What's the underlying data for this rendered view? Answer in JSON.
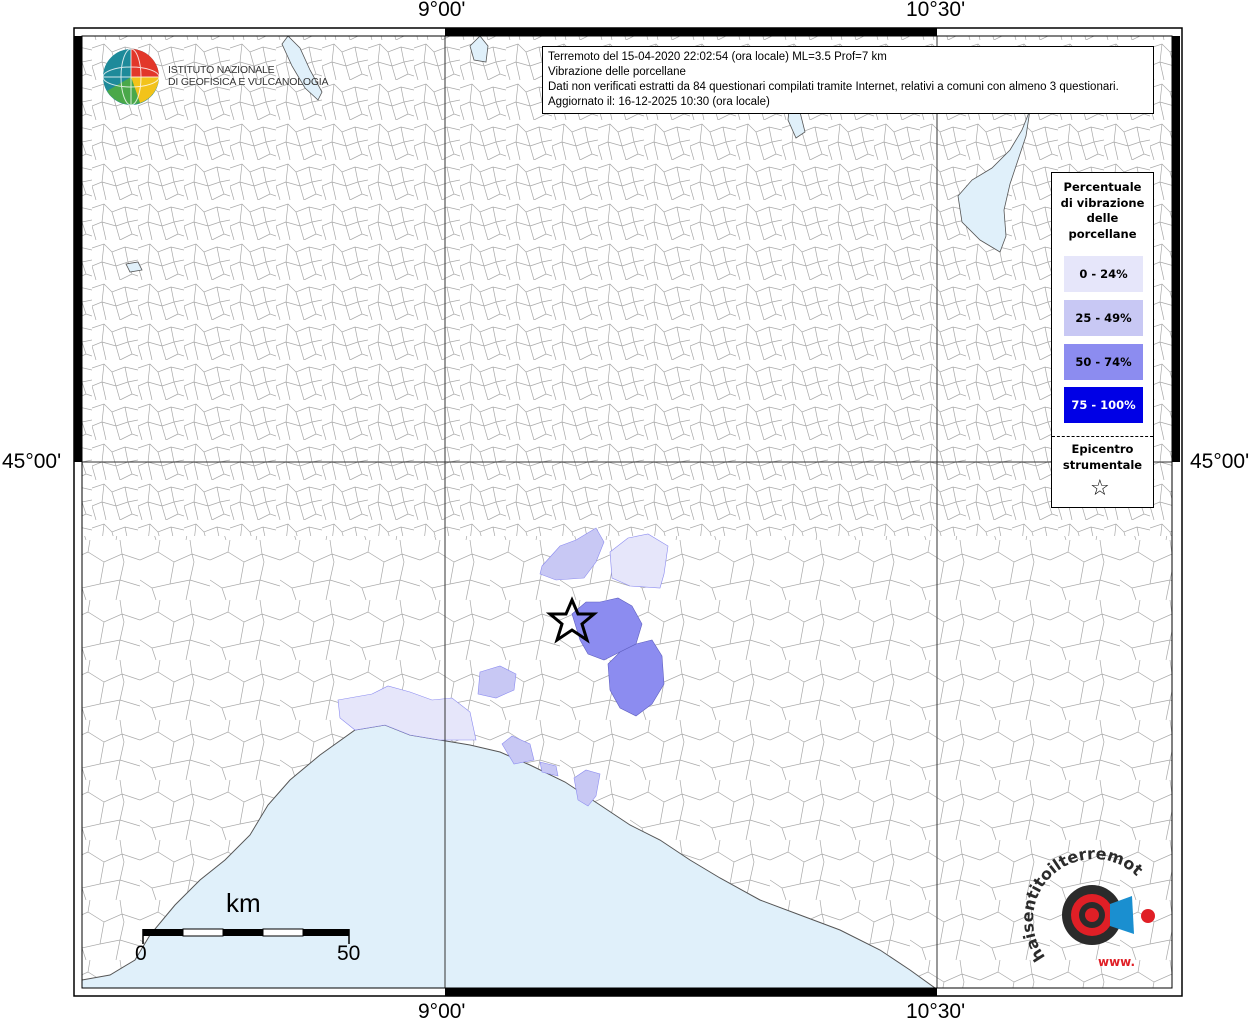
{
  "title": {
    "line1": "Terremoto del 15-04-2020 22:02:54 (ora locale) ML=3.5 Prof=7 km",
    "line2": "Vibrazione delle porcellane",
    "line3": "Dati non verificati estratti da 84 questionari compilati tramite Internet, relativi a comuni con almeno 3 questionari.",
    "line4": "Aggiornato il: 16-12-2025 10:30 (ora locale)"
  },
  "axes": {
    "top_left": "9°00'",
    "top_right": "10°30'",
    "bottom_left": "9°00'",
    "bottom_right": "10°30'",
    "left_lat": "45°00'",
    "right_lat": "45°00'"
  },
  "logo_ingv": {
    "line1": "ISTITUTO NAZIONALE",
    "line2": "DI GEOFISICA E VULCANOLOGIA"
  },
  "logo_hsit": {
    "text": "haisentitoilterremoto.it",
    "prefix": "www."
  },
  "legend": {
    "title_lines": [
      "Percentuale",
      "di vibrazione",
      "delle",
      "porcellane"
    ],
    "classes": [
      {
        "label": "0 - 24%",
        "color": "#e6e6fa",
        "text_color": "#000000"
      },
      {
        "label": "25 - 49%",
        "color": "#c8c8f4",
        "text_color": "#000000"
      },
      {
        "label": "50 - 74%",
        "color": "#8c8cf0",
        "text_color": "#000000"
      },
      {
        "label": "75 - 100%",
        "color": "#0000e6",
        "text_color": "#ffffff"
      }
    ],
    "epicenter_lines": [
      "Epicentro",
      "strumentale"
    ],
    "epicenter_symbol": "☆"
  },
  "scale_bar": {
    "unit": "km",
    "min_label": "0",
    "max_label": "50"
  },
  "colors": {
    "sea": "#e0f0fa",
    "land": "#ffffff",
    "border": "#9a9a9a"
  }
}
